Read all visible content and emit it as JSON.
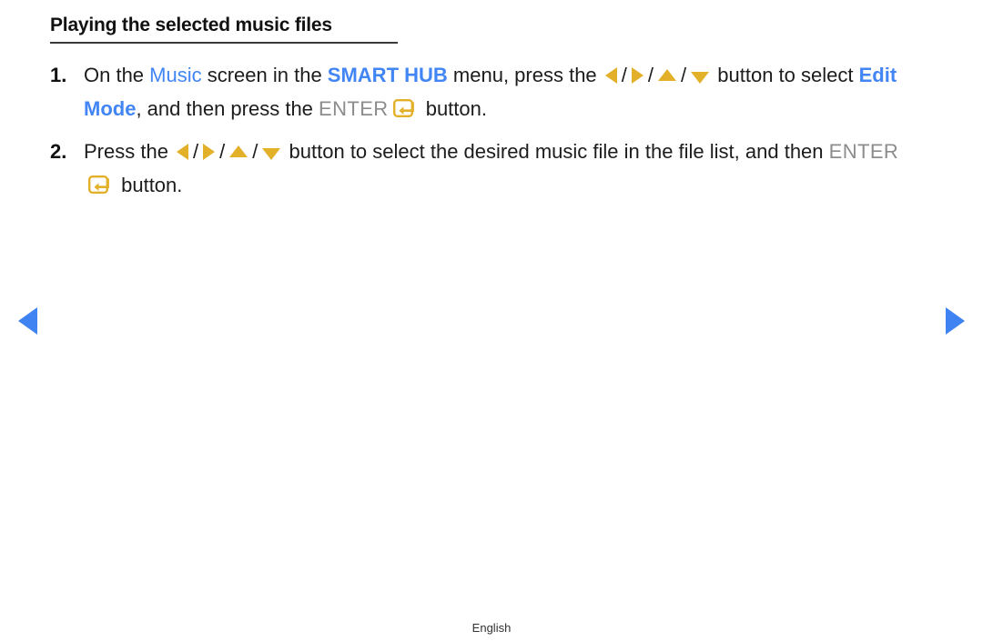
{
  "page": {
    "title": "Playing the selected music files",
    "language_label": "English",
    "background_color": "#ffffff",
    "accent_blue": "#4285f4",
    "accent_amber": "#e3b02a",
    "muted_gray": "#8c8c8c",
    "nav_blue": "#3f82f2"
  },
  "steps": [
    {
      "number": "1.",
      "seg_1": "On the ",
      "kw_music": "Music",
      "seg_2": " screen in the ",
      "kw_smart_hub": "SMART HUB",
      "seg_3": " menu, press the ",
      "arrow_left": "left-arrow",
      "sep_1": "/",
      "arrow_right": "right-arrow",
      "sep_2": "/",
      "arrow_up": "up-arrow",
      "sep_3": "/",
      "arrow_down": "down-arrow",
      "seg_4": " button to select ",
      "kw_edit_mode": "Edit Mode",
      "seg_5": ", and then press the ",
      "kw_enter": "ENTER",
      "enter_icon": "enter-key-icon",
      "seg_6": " button."
    },
    {
      "number": "2.",
      "seg_1": "Press the ",
      "arrow_left": "left-arrow",
      "sep_1": "/",
      "arrow_right": "right-arrow",
      "sep_2": "/",
      "arrow_up": "up-arrow",
      "sep_3": "/",
      "arrow_down": "down-arrow",
      "seg_2": " button to select the desired music file in the file list, and then ",
      "kw_enter": "ENTER",
      "enter_icon": "enter-key-icon",
      "seg_3": " button."
    }
  ],
  "navigation": {
    "prev_label": "previous-page",
    "next_label": "next-page"
  }
}
